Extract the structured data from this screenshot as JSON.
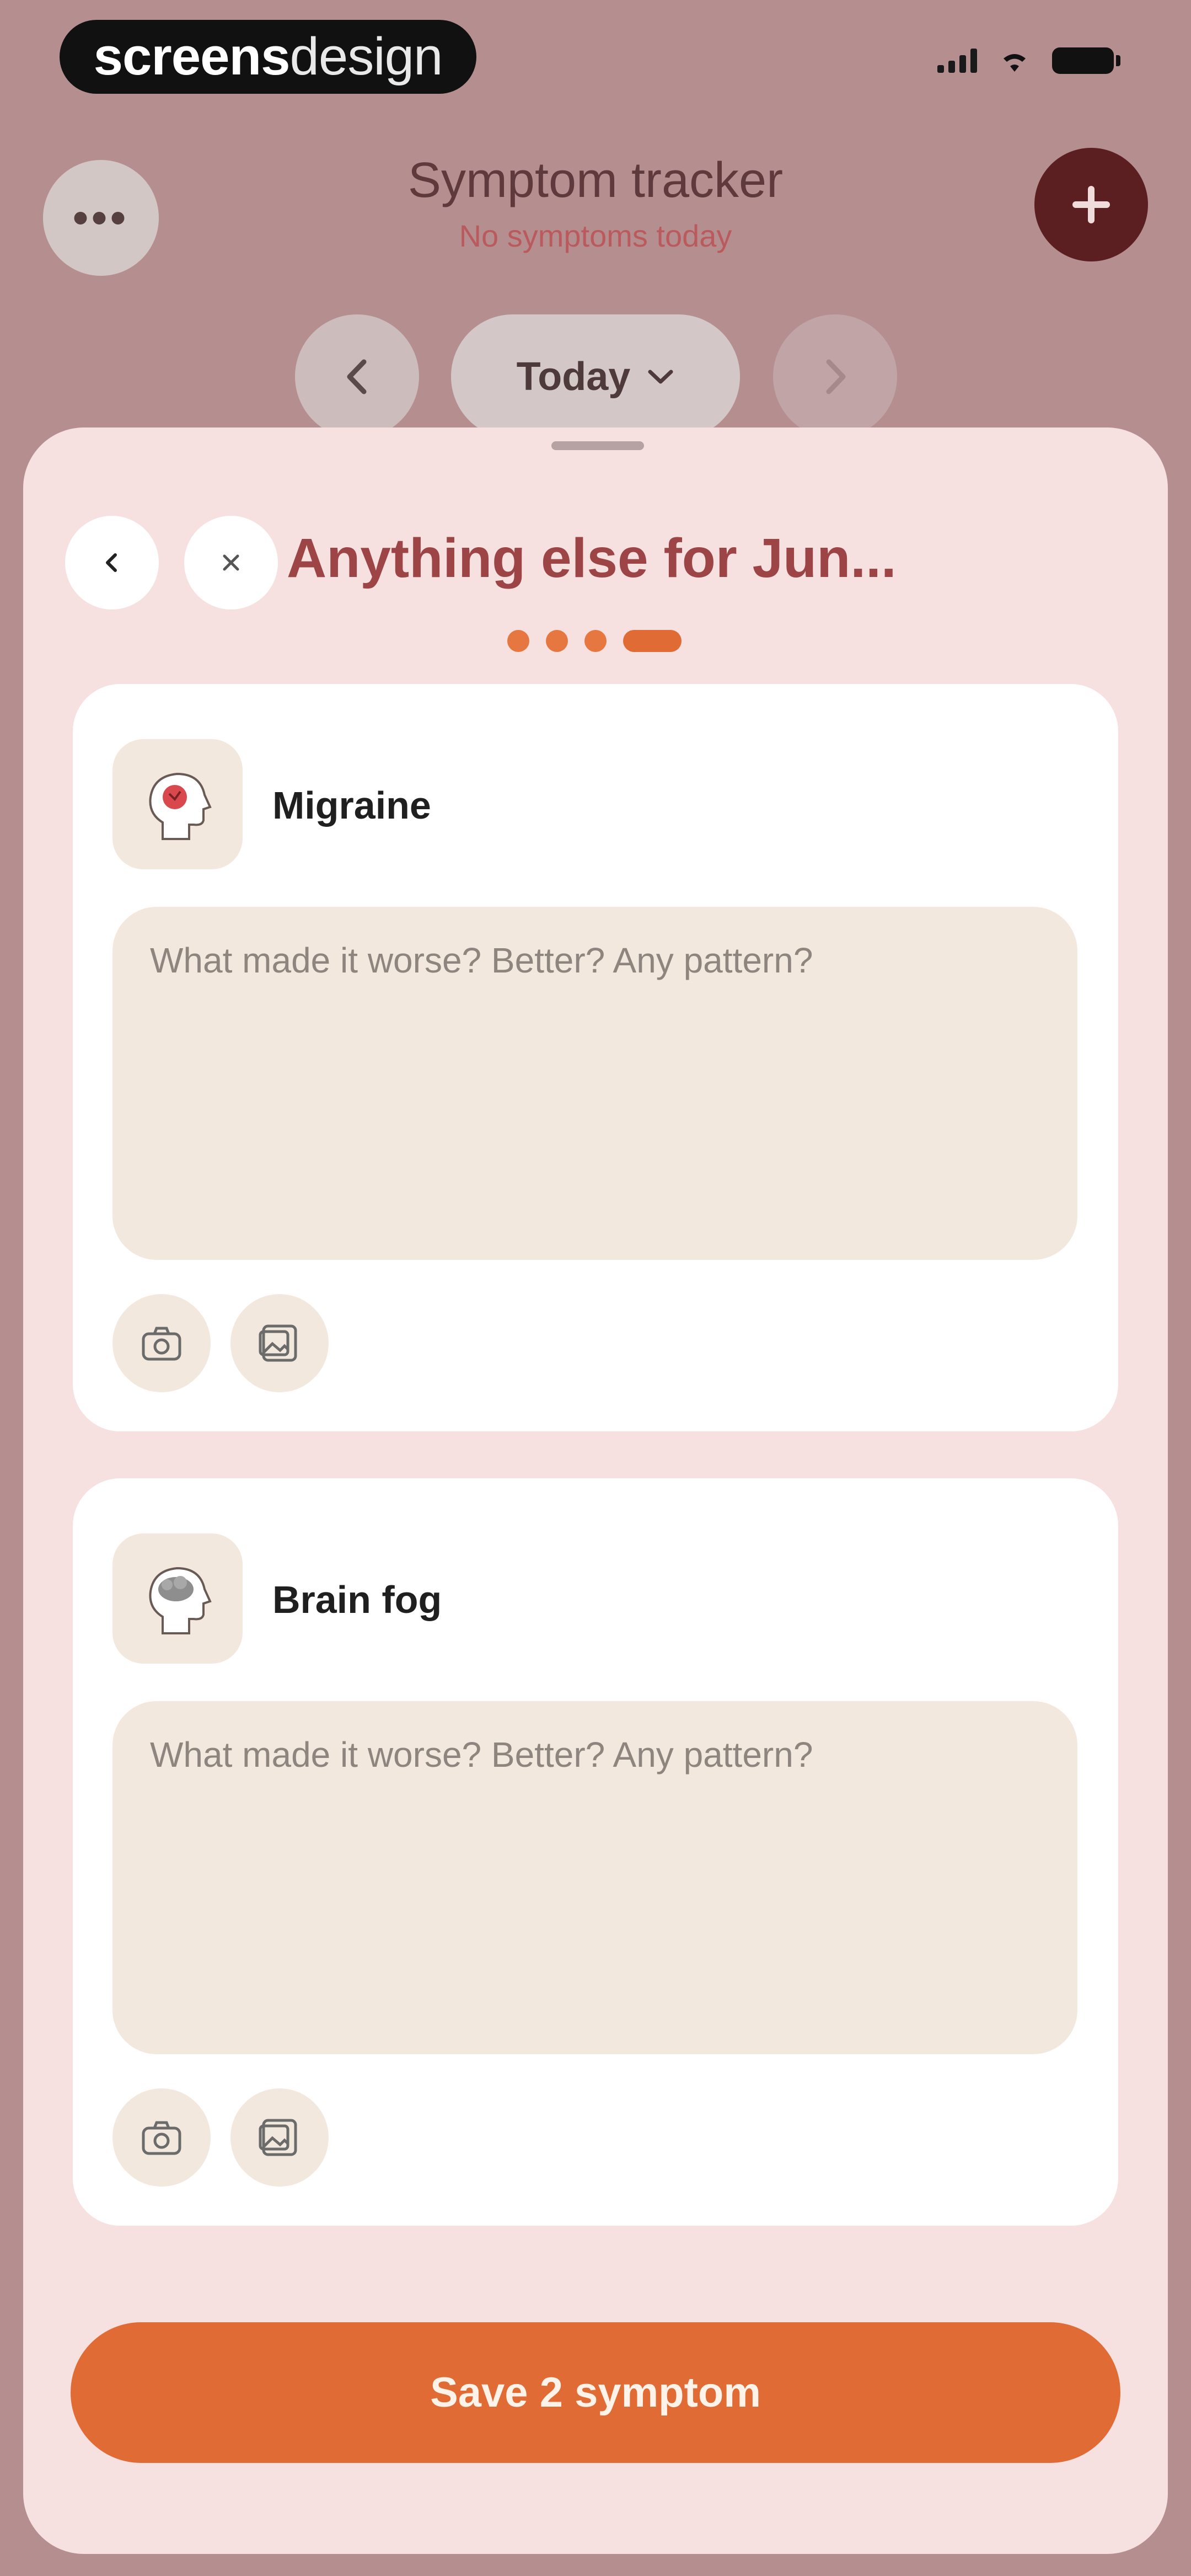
{
  "brand": {
    "bold": "screens",
    "light": "design"
  },
  "header": {
    "title": "Symptom tracker",
    "subtitle": "No symptoms today",
    "date_selector": "Today"
  },
  "sheet": {
    "title": "Anything else for Jun...",
    "steps_total": 4,
    "current_step": 4
  },
  "symptoms": [
    {
      "name": "Migraine",
      "icon": "migraine-head-icon",
      "note_placeholder": "What made it worse? Better? Any pattern?"
    },
    {
      "name": "Brain fog",
      "icon": "brain-fog-head-icon",
      "note_placeholder": "What made it worse? Better? Any pattern?"
    }
  ],
  "save_button": "Save 2 symptom",
  "colors": {
    "background": "#b58e90",
    "sheet": "#f7e0e0",
    "accent": "#e06b35",
    "add_button": "#5b1e21",
    "title": "#9d4446"
  }
}
